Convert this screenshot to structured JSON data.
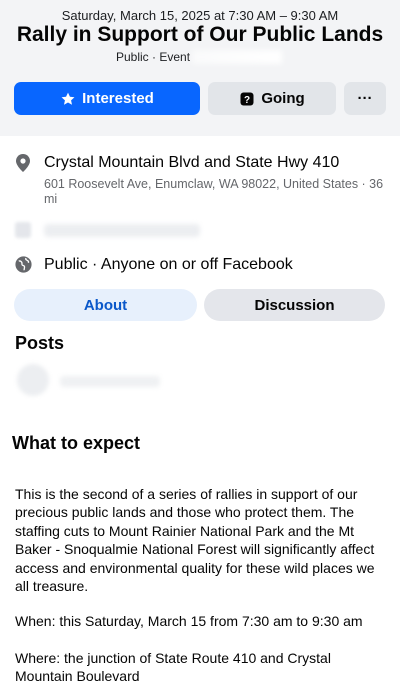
{
  "event": {
    "date_time": "Saturday, March 15, 2025 at 7:30 AM – 9:30 AM",
    "title": "Rally in Support of Our Public Lands",
    "subtitle": "Public · Event"
  },
  "actions": {
    "interested_label": "Interested",
    "going_label": "Going",
    "more_label": "···"
  },
  "location": {
    "name": "Crystal Mountain Blvd and State Hwy 410",
    "address": "601 Roosevelt Ave, Enumclaw, WA 98022, United States · 36 mi"
  },
  "privacy": {
    "text": "Public · Anyone on or off Facebook"
  },
  "tabs": [
    {
      "label": "About",
      "active": true
    },
    {
      "label": "Discussion",
      "active": false
    }
  ],
  "posts": {
    "heading": "Posts"
  },
  "about": {
    "heading": "What to expect",
    "paragraphs": [
      "This is the second of a series of rallies in support of our precious public lands and those who protect them. The staffing cuts to Mount Rainier National Park and the Mt Baker - Snoqualmie National Forest will significantly affect access and environmental quality for these wild places we all treasure.",
      "When: this Saturday, March 15 from 7:30 am to 9:30 am",
      "Where: the junction of State Route 410 and Crystal Mountain Boulevard"
    ]
  },
  "colors": {
    "accent": "#0866ff",
    "header_bg": "#f3f4f6",
    "secondary_button": "#e2e5e9",
    "about_tab_bg": "#e7f0fc",
    "about_tab_text": "#0a58ca",
    "muted_text": "#65676b"
  },
  "icons": {
    "interested": "star-icon",
    "going": "question-badge-icon",
    "location": "map-pin-icon",
    "privacy": "globe-icon"
  }
}
